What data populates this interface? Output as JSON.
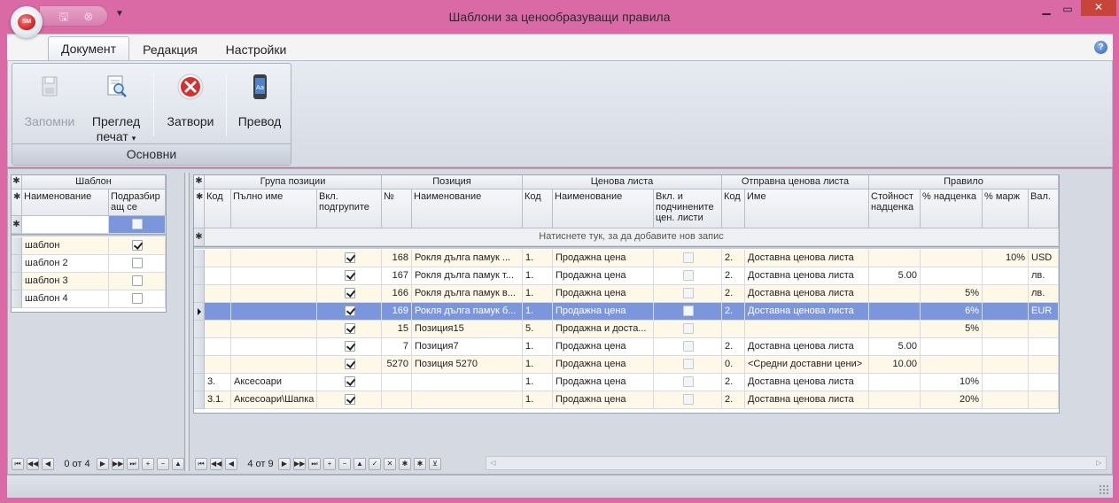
{
  "window": {
    "title": "Шаблони за ценообразуващи правила",
    "app_badge": "SM",
    "qat_save_glyph": "🖫",
    "qat_close_glyph": "⊗",
    "qat_dropdown_glyph": "▼",
    "min_glyph": "▁",
    "max_glyph": "▭",
    "close_glyph": "✕",
    "background_color": "#d96aa5"
  },
  "ribbon": {
    "tabs": [
      {
        "label": "Документ",
        "active": true
      },
      {
        "label": "Редакция",
        "active": false
      },
      {
        "label": "Настройки",
        "active": false
      }
    ],
    "help_glyph": "?",
    "group": {
      "caption": "Основни",
      "buttons": [
        {
          "label": "Запомни",
          "icon": "save-icon",
          "enabled": false
        },
        {
          "label": "Преглед",
          "label2": "печат",
          "dropdown": "▾",
          "icon": "print-preview-icon",
          "enabled": true
        },
        {
          "label": "Затвори",
          "icon": "close-circle-icon",
          "enabled": true
        },
        {
          "label": "Превод",
          "icon": "translate-phone-icon",
          "enabled": true
        }
      ]
    }
  },
  "left_grid": {
    "band": "Шаблон",
    "columns": [
      "Наименование",
      "Подразбир ащ се"
    ],
    "rows": [
      {
        "name": "шаблон",
        "default": true
      },
      {
        "name": "шаблон 2",
        "default": false
      },
      {
        "name": "шаблон 3",
        "default": false
      },
      {
        "name": "шаблон 4",
        "default": false
      }
    ],
    "nav": {
      "position": "0 от 4"
    }
  },
  "right_grid": {
    "bands": [
      "Група позиции",
      "Позиция",
      "Ценова листа",
      "Отправна ценова листа",
      "Правило"
    ],
    "columns": [
      "Код",
      "Пълно име",
      "Вкл. подгрупите",
      "№",
      "Наименование",
      "Код",
      "Наименование",
      "Вкл. и подчинените цен. листи",
      "Код",
      "Име",
      "Стойност надценка",
      "% надценка",
      "% марж",
      "Вал."
    ],
    "new_row_text": "Натиснете тук, за да добавите нов запис",
    "rows": [
      {
        "g_code": "",
        "g_name": "",
        "g_incl": true,
        "p_no": "168",
        "p_name": "Рокля дълга  памук ...",
        "pl_code": "1.",
        "pl_name": "Продажна цена",
        "pl_incl": false,
        "b_code": "2.",
        "b_name": "Доставна ценова листа",
        "r_value": "",
        "r_markup": "",
        "r_margin": "10%",
        "r_cur": "USD"
      },
      {
        "g_code": "",
        "g_name": "",
        "g_incl": true,
        "p_no": "167",
        "p_name": "Рокля дълга  памук т...",
        "pl_code": "1.",
        "pl_name": "Продажна цена",
        "pl_incl": false,
        "b_code": "2.",
        "b_name": "Доставна ценова листа",
        "r_value": "5.00",
        "r_markup": "",
        "r_margin": "",
        "r_cur": "лв."
      },
      {
        "g_code": "",
        "g_name": "",
        "g_incl": true,
        "p_no": "166",
        "p_name": "Рокля дълга памук в...",
        "pl_code": "1.",
        "pl_name": "Продажна цена",
        "pl_incl": false,
        "b_code": "2.",
        "b_name": "Доставна ценова листа",
        "r_value": "",
        "r_markup": "5%",
        "r_margin": "",
        "r_cur": "лв."
      },
      {
        "g_code": "",
        "g_name": "",
        "g_incl": true,
        "p_no": "169",
        "p_name": "Рокля дълга памук б...",
        "pl_code": "1.",
        "pl_name": "Продажна цена",
        "pl_incl": false,
        "b_code": "2.",
        "b_name": "Доставна ценова листа",
        "r_value": "",
        "r_markup": "6%",
        "r_margin": "",
        "r_cur": "EUR",
        "selected": true
      },
      {
        "g_code": "",
        "g_name": "",
        "g_incl": true,
        "p_no": "15",
        "p_name": "Позиция15",
        "pl_code": "5.",
        "pl_name": "Продажна и доста...",
        "pl_incl": false,
        "b_code": "",
        "b_name": "",
        "r_value": "",
        "r_markup": "5%",
        "r_margin": "",
        "r_cur": ""
      },
      {
        "g_code": "",
        "g_name": "",
        "g_incl": true,
        "p_no": "7",
        "p_name": "Позиция7",
        "pl_code": "1.",
        "pl_name": "Продажна цена",
        "pl_incl": false,
        "b_code": "2.",
        "b_name": "Доставна ценова листа",
        "r_value": "5.00",
        "r_markup": "",
        "r_margin": "",
        "r_cur": ""
      },
      {
        "g_code": "",
        "g_name": "",
        "g_incl": true,
        "p_no": "5270",
        "p_name": "Позиция 5270",
        "pl_code": "1.",
        "pl_name": "Продажна цена",
        "pl_incl": false,
        "b_code": "0.",
        "b_name": "<Средни доставни цени>",
        "r_value": "10.00",
        "r_markup": "",
        "r_margin": "",
        "r_cur": ""
      },
      {
        "g_code": "3.",
        "g_name": "Аксесоари",
        "g_incl": true,
        "p_no": "",
        "p_name": "",
        "pl_code": "1.",
        "pl_name": "Продажна цена",
        "pl_incl": false,
        "b_code": "2.",
        "b_name": "Доставна ценова листа",
        "r_value": "",
        "r_markup": "10%",
        "r_margin": "",
        "r_cur": ""
      },
      {
        "g_code": "3.1.",
        "g_name": "Аксесоари\\Шапка",
        "g_incl": true,
        "p_no": "",
        "p_name": "",
        "pl_code": "1.",
        "pl_name": "Продажна цена",
        "pl_incl": false,
        "b_code": "2.",
        "b_name": "Доставна ценова листа",
        "r_value": "",
        "r_markup": "20%",
        "r_margin": "",
        "r_cur": ""
      }
    ],
    "nav": {
      "position": "4 от 9"
    }
  },
  "nav_glyphs": {
    "first": "⏮",
    "prev_page": "◀◀",
    "prev": "◀",
    "next": "▶",
    "next_page": "▶▶",
    "last": "⏭",
    "append": "+",
    "remove": "−",
    "up": "▲",
    "check": "✓",
    "cancel": "✕",
    "asterisk": "✱",
    "filter": "⊻",
    "scroll_left": "◁",
    "scroll_right": "▷",
    "star": "✱"
  },
  "colors": {
    "selection_row": "#7b96dc",
    "alt_row": "#fdf8e8",
    "frame_pink": "#d96aa5"
  }
}
